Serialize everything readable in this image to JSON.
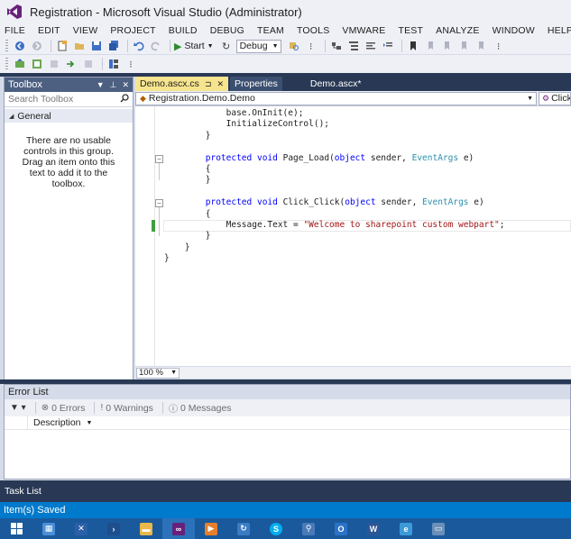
{
  "window": {
    "title": "Registration - Microsoft Visual Studio (Administrator)"
  },
  "menu": [
    "FILE",
    "EDIT",
    "VIEW",
    "PROJECT",
    "BUILD",
    "DEBUG",
    "TEAM",
    "TOOLS",
    "VMWARE",
    "TEST",
    "ANALYZE",
    "WINDOW",
    "HELP"
  ],
  "toolbar": {
    "start_label": "Start",
    "config_value": "Debug"
  },
  "toolbox": {
    "title": "Toolbox",
    "search_placeholder": "Search Toolbox",
    "group_label": "General",
    "empty_message": "There are no usable controls in this group. Drag an item onto this text to add it to the toolbox."
  },
  "editor": {
    "tabs": [
      {
        "label": "Demo.ascx.cs",
        "active": true
      },
      {
        "label": "Properties",
        "active": false
      },
      {
        "label": "Demo.ascx*",
        "active": false
      }
    ],
    "nav_class": "Registration.Demo.Demo",
    "nav_member": "Click",
    "zoom": "100 %"
  },
  "code": {
    "lines": [
      [
        {
          "t": "            base.OnInit(e);",
          "c": ""
        }
      ],
      [
        {
          "t": "            InitializeControl();",
          "c": ""
        }
      ],
      [
        {
          "t": "        }",
          "c": ""
        }
      ],
      [
        {
          "t": "",
          "c": ""
        }
      ],
      [
        {
          "t": "        ",
          "c": ""
        },
        {
          "t": "protected",
          "c": "kw"
        },
        {
          "t": " ",
          "c": ""
        },
        {
          "t": "void",
          "c": "kw"
        },
        {
          "t": " Page_Load(",
          "c": ""
        },
        {
          "t": "object",
          "c": "kw"
        },
        {
          "t": " sender, ",
          "c": ""
        },
        {
          "t": "EventArgs",
          "c": "ty"
        },
        {
          "t": " e)",
          "c": ""
        }
      ],
      [
        {
          "t": "        {",
          "c": ""
        }
      ],
      [
        {
          "t": "        }",
          "c": ""
        }
      ],
      [
        {
          "t": "",
          "c": ""
        }
      ],
      [
        {
          "t": "        ",
          "c": ""
        },
        {
          "t": "protected",
          "c": "kw"
        },
        {
          "t": " ",
          "c": ""
        },
        {
          "t": "void",
          "c": "kw"
        },
        {
          "t": " Click_Click(",
          "c": ""
        },
        {
          "t": "object",
          "c": "kw"
        },
        {
          "t": " sender, ",
          "c": ""
        },
        {
          "t": "EventArgs",
          "c": "ty"
        },
        {
          "t": " e)",
          "c": ""
        }
      ],
      [
        {
          "t": "        {",
          "c": ""
        }
      ],
      [
        {
          "t": "            Message.Text = ",
          "c": ""
        },
        {
          "t": "\"Welcome to sharepoint custom webpart\"",
          "c": "str"
        },
        {
          "t": ";",
          "c": ""
        }
      ],
      [
        {
          "t": "        }",
          "c": ""
        }
      ],
      [
        {
          "t": "    }",
          "c": ""
        }
      ],
      [
        {
          "t": "}",
          "c": ""
        }
      ]
    ]
  },
  "error_list": {
    "title": "Error List",
    "errors": "0 Errors",
    "warnings": "0 Warnings",
    "messages": "0 Messages",
    "column_description": "Description"
  },
  "task_list": {
    "title": "Task List"
  },
  "status": {
    "text": "Item(s) Saved"
  },
  "taskbar": {
    "apps": [
      "start",
      "file-manager",
      "server-manager",
      "powershell",
      "explorer",
      "visual-studio",
      "media",
      "sync",
      "skype",
      "network",
      "outlook",
      "word",
      "ie",
      "remote"
    ]
  }
}
